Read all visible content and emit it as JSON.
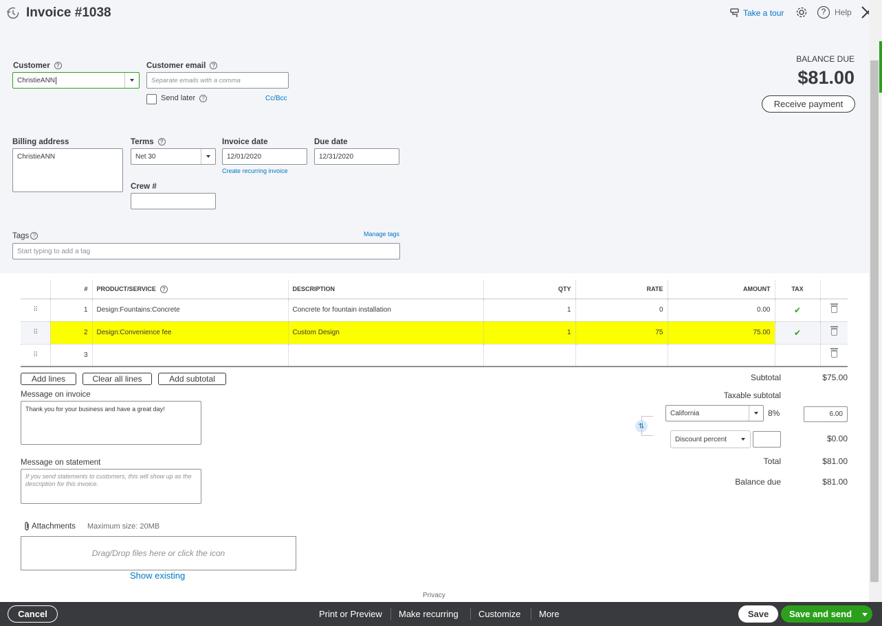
{
  "header": {
    "title": "Invoice #1038",
    "take_tour": "Take a tour",
    "help": "Help"
  },
  "balance": {
    "label": "BALANCE DUE",
    "amount": "$81.00",
    "receive_payment": "Receive payment"
  },
  "customer": {
    "label": "Customer",
    "value": "ChristieANN"
  },
  "email": {
    "label": "Customer email",
    "placeholder": "Separate emails with a comma",
    "send_later": "Send later",
    "ccbcc": "Cc/Bcc"
  },
  "billing": {
    "label": "Billing address",
    "value": "ChristieANN"
  },
  "terms": {
    "label": "Terms",
    "value": "Net 30"
  },
  "invoice_date": {
    "label": "Invoice date",
    "value": "12/01/2020",
    "recurring_link": "Create recurring invoice"
  },
  "due_date": {
    "label": "Due date",
    "value": "12/31/2020"
  },
  "crew": {
    "label": "Crew #",
    "value": ""
  },
  "tags": {
    "label": "Tags",
    "manage": "Manage tags",
    "placeholder": "Start typing to add a tag"
  },
  "table": {
    "headers": {
      "num": "#",
      "product": "PRODUCT/SERVICE",
      "description": "DESCRIPTION",
      "qty": "QTY",
      "rate": "RATE",
      "amount": "AMOUNT",
      "tax": "TAX"
    },
    "rows": [
      {
        "num": "1",
        "product": "Design:Fountains:Concrete",
        "description": "Concrete for fountain installation",
        "qty": "1",
        "rate": "0",
        "amount": "0.00",
        "taxed": true
      },
      {
        "num": "2",
        "product": "Design:Convenience fee",
        "description": "Custom Design",
        "qty": "1",
        "rate": "75",
        "amount": "75.00",
        "taxed": true
      },
      {
        "num": "3",
        "product": "",
        "description": "",
        "qty": "",
        "rate": "",
        "amount": "",
        "taxed": false
      }
    ]
  },
  "line_buttons": {
    "add_lines": "Add lines",
    "clear_all": "Clear all lines",
    "add_subtotal": "Add subtotal"
  },
  "message_invoice": {
    "label": "Message on invoice",
    "value": "Thank you for your business and have a great day!"
  },
  "message_statement": {
    "label": "Message on statement",
    "placeholder": "If you send statements to customers, this will show up as the description for this invoice."
  },
  "attachments": {
    "label": "Attachments",
    "max_size": "Maximum size: 20MB",
    "drop_text": "Drag/Drop files here or click the icon",
    "show_existing": "Show existing"
  },
  "totals": {
    "subtotal_label": "Subtotal",
    "subtotal_value": "$75.00",
    "taxable_label": "Taxable subtotal",
    "tax_region": "California",
    "tax_rate": "8%",
    "tax_amount": "6.00",
    "discount_type": "Discount percent",
    "discount_value": "",
    "discount_amount": "$0.00",
    "total_label": "Total",
    "total_value": "$81.00",
    "balance_label": "Balance due",
    "balance_value": "$81.00"
  },
  "privacy": "Privacy",
  "footer": {
    "cancel": "Cancel",
    "print_preview": "Print or Preview",
    "make_recurring": "Make recurring",
    "customize": "Customize",
    "more": "More",
    "save": "Save",
    "save_send": "Save and send"
  },
  "colors": {
    "green": "#2ca01c",
    "link": "#0077c5",
    "highlight": "#fbff00",
    "footer_bg": "#393a3d"
  }
}
